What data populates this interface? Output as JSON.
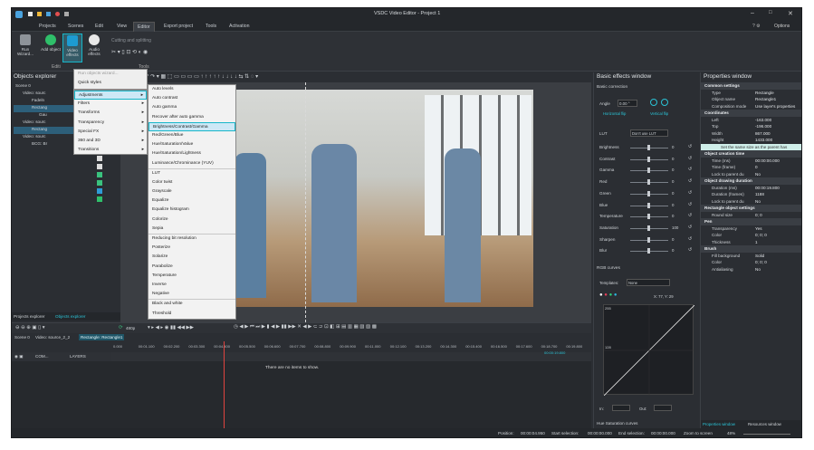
{
  "app_title": "VSDC Video Editor - Project 1",
  "options_label": "Options",
  "menu": [
    "Projects",
    "Scenes",
    "Edit",
    "View",
    "Editor",
    "Export project",
    "Tools",
    "Activation"
  ],
  "ribbon": {
    "run_wizard": "Run Wizard...",
    "add_object": "Add object",
    "video_effects": "Video effects",
    "audio_effects": "Audio effects",
    "cutting": "Cutting and splitting",
    "editing_group": "Editi",
    "tools_group": "Tools"
  },
  "objects_explorer": {
    "title": "Objects explorer",
    "tree": [
      "Scene 0",
      "Video: sourc",
      "Fadeln",
      "Rectang",
      "Gau",
      "Video: sourc",
      "Rectang",
      "Video: sourc",
      "BCG: Br"
    ]
  },
  "bottom_tabs": [
    "Projects explorer",
    "Objects explorer"
  ],
  "menu_top": {
    "run_objects_wizard": "Run objects wizard...",
    "quick_styles": "Quick styles"
  },
  "menu_main": [
    "Adjustments",
    "Filters",
    "Transforms",
    "Transparency",
    "Special FX",
    "360 and 3D",
    "Transitions"
  ],
  "menu_sub": [
    "Auto levels",
    "Auto contrast",
    "Auto gamma",
    "Recover after auto gamma",
    "Brightness/Contrast/Gamma",
    "Red/Green/Blue",
    "Hue/Saturation/Value",
    "Hue/Saturation/Lightness",
    "Luminance/Chrominance (YUV)",
    "LUT",
    "Color twist",
    "Grayscale",
    "Equalize",
    "Equalize histogram",
    "Colorize",
    "Sepia",
    "Reducing bit resolution",
    "Posterize",
    "Solarize",
    "Parabolize",
    "Temperature",
    "Inverse",
    "Negative",
    "Black and white",
    "Threshold"
  ],
  "basic_effects": {
    "title": "Basic effects window",
    "basic_correction": "Basic correction",
    "angle_label": "Angle",
    "angle_value": "0.00 °",
    "hflip": "Horizontal flip",
    "vflip": "Vertical flip",
    "lut_label": "LUT",
    "lut_value": "Don't use LUT",
    "sliders": [
      {
        "label": "Brightness",
        "value": "0"
      },
      {
        "label": "Contrast",
        "value": "0"
      },
      {
        "label": "Gamma",
        "value": "0"
      },
      {
        "label": "Red",
        "value": "0"
      },
      {
        "label": "Green",
        "value": "0"
      },
      {
        "label": "Blue",
        "value": "0"
      },
      {
        "label": "Temperature",
        "value": "0"
      },
      {
        "label": "Saturation",
        "value": "100"
      },
      {
        "label": "Sharpen",
        "value": "0"
      },
      {
        "label": "Blur",
        "value": "0"
      }
    ],
    "rgb_curves": "RGB curves",
    "templates_label": "Templates:",
    "templates_value": "None",
    "coords": "X: 77, Y: 29",
    "curve_top": "255",
    "curve_mid": "128",
    "in_label": "In:",
    "out_label": "Out:",
    "hue_sat_curves": "Hue Saturation curves"
  },
  "properties": {
    "title": "Properties window",
    "rows": [
      {
        "type": "sec",
        "k": "Common settings"
      },
      {
        "k": "Type",
        "v": "Rectangle"
      },
      {
        "k": "Object name",
        "v": "Rectangle1"
      },
      {
        "k": "Composition mode",
        "v": "Use layer's properties"
      },
      {
        "type": "sec",
        "k": "Coordinates"
      },
      {
        "k": "Left",
        "v": "-163.000"
      },
      {
        "k": "Top",
        "v": "-196.000"
      },
      {
        "k": "Width",
        "v": "867.000"
      },
      {
        "k": "Height",
        "v": "1433.000"
      },
      {
        "type": "note",
        "k": "Set the same size as the parent has"
      },
      {
        "type": "sec",
        "k": "Object creation time"
      },
      {
        "k": "Time (ms)",
        "v": "00:00:00.000"
      },
      {
        "k": "Time (frame)",
        "v": "0"
      },
      {
        "k": "Lock to parent du",
        "v": "No"
      },
      {
        "type": "sec",
        "k": "Object drawing duration"
      },
      {
        "k": "Duration (ms)",
        "v": "00:00:19.800"
      },
      {
        "k": "Duration (frames)",
        "v": "1188"
      },
      {
        "k": "Lock to parent du",
        "v": "No"
      },
      {
        "type": "sec",
        "k": "Rectangle object settings"
      },
      {
        "k": "Round size",
        "v": "0; 0"
      },
      {
        "type": "sec",
        "k": "Pen"
      },
      {
        "k": "Transparency",
        "v": "Yes"
      },
      {
        "k": "Color",
        "v": "0; 0; 0"
      },
      {
        "k": "Thickness",
        "v": "1"
      },
      {
        "type": "sec",
        "k": "Brush"
      },
      {
        "k": "Fill background",
        "v": "Solid"
      },
      {
        "k": "Color",
        "v": "0; 0; 0"
      },
      {
        "k": "Antialiasing",
        "v": "No"
      }
    ],
    "tabs": [
      "Properties window",
      "Resources window"
    ]
  },
  "timeline": {
    "zoom": "480p",
    "tabs": [
      "Scene 0",
      "Video: source_2_2",
      "Rectangle: Rectangle1"
    ],
    "com_label": "COM...",
    "layers_label": "LAYERS",
    "empty": "There are no items to show.",
    "ticks": [
      "0.000",
      "00:01.100",
      "00:02.200",
      "00:03.300",
      "00:04.400",
      "00:05.500",
      "00:06.600",
      "00:07.700",
      "00:08.800",
      "00:09.900",
      "00:11.000",
      "00:12.100",
      "00:13.200",
      "00:14.300",
      "00:15.400",
      "00:16.500",
      "00:17.600",
      "00:18.700",
      "00:19.800"
    ],
    "end_marker": "00:00:19.800"
  },
  "status": {
    "position_label": "Position:",
    "position": "00:00:04.950",
    "start_sel_label": "Start selection:",
    "start_sel": "00:00:00.000",
    "end_sel_label": "End selection:",
    "end_sel": "00:00:00.000",
    "zoom_label": "Zoom to screen",
    "zoom": "48%"
  }
}
